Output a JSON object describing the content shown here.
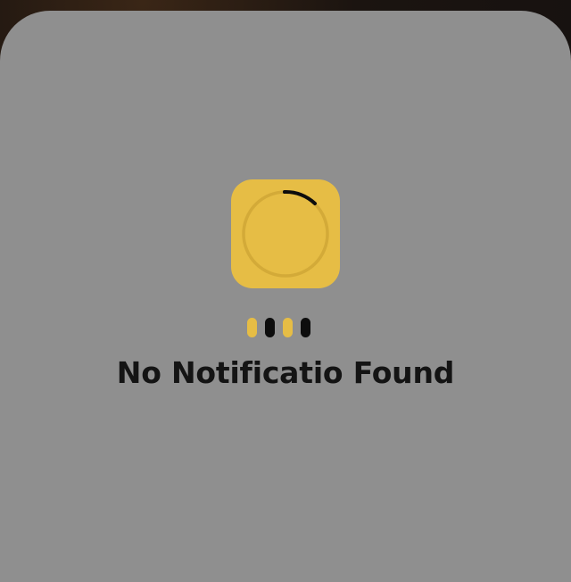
{
  "empty_state": {
    "message": "No Notificatio Found"
  },
  "loader": {
    "icon": "loading-spinner-icon",
    "dots": [
      {
        "color": "#e6bd45"
      },
      {
        "color": "#0d0d0d"
      },
      {
        "color": "#e6bd45"
      },
      {
        "color": "#0d0d0d"
      }
    ]
  },
  "colors": {
    "sheet": "#8f8f8f",
    "accent": "#e6bd45",
    "text": "#141414"
  }
}
